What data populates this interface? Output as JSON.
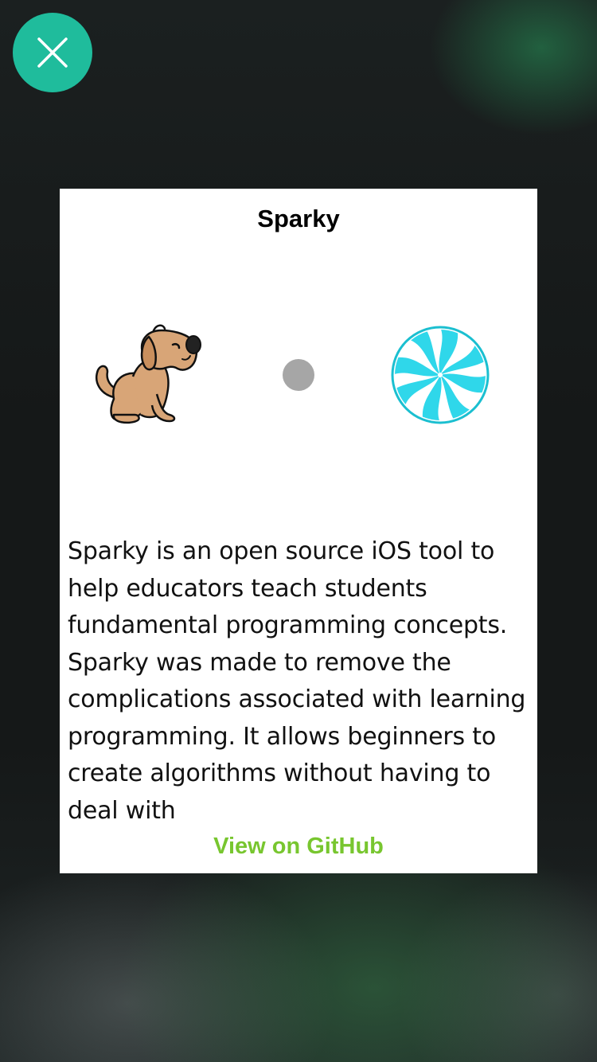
{
  "close_button": {
    "icon": "close-icon",
    "color": "#1fbc9c"
  },
  "card": {
    "title": "Sparky",
    "images": {
      "left": "dog-icon",
      "middle": "dot-icon",
      "right": "candy-icon"
    },
    "description": "Sparky is an open source iOS tool to help educators teach students fundamental programming concepts. Sparky was made to remove the complications associated with learning programming. It allows beginners to create algorithms without having to deal with",
    "link_label": "View on GitHub",
    "link_color": "#78c62f"
  }
}
